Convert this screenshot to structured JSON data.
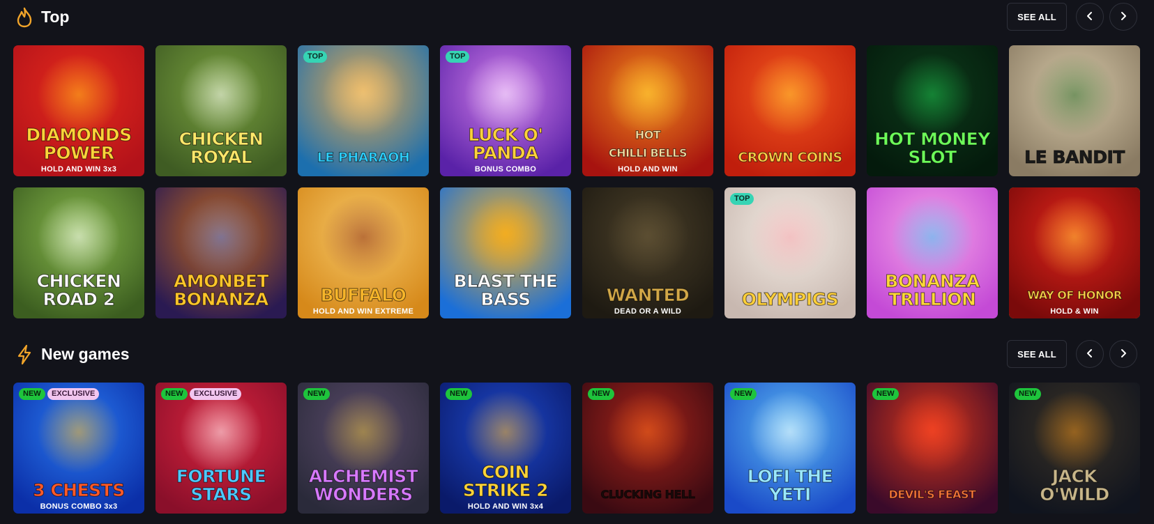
{
  "sections": [
    {
      "title": "Top",
      "icon": "fire-icon",
      "see_all": "SEE ALL",
      "prev_icon": "chevron-left-icon",
      "next_icon": "chevron-right-icon",
      "games": [
        {
          "line1": "DIAMONDS",
          "line2": "POWER",
          "sub": "HOLD AND WIN 3x3",
          "badges": [],
          "bg": [
            "#b3121a",
            "#e42a1c"
          ],
          "glow": "#ffc21a",
          "text": "#ffd43a"
        },
        {
          "line1": "CHICKEN",
          "line2": "ROYAL",
          "sub": "",
          "badges": [],
          "bg": [
            "#3f5c23",
            "#79a03e"
          ],
          "glow": "#ffffff",
          "text": "#ffe86a"
        },
        {
          "line1": "LE PHARAOH",
          "line2": "",
          "sub": "",
          "badges": [
            "TOP"
          ],
          "bg": [
            "#1c6fae",
            "#e2a852"
          ],
          "glow": "#f6d38a",
          "text": "#2fd0ff"
        },
        {
          "line1": "LUCK O'",
          "line2": "PANDA",
          "sub": "BONUS COMBO",
          "badges": [
            "TOP"
          ],
          "bg": [
            "#5a22a8",
            "#d07ce8"
          ],
          "glow": "#f8f0ff",
          "text": "#ffd23c"
        },
        {
          "line1": "HOT",
          "line2": "CHILLI BELLS",
          "sub": "HOLD AND WIN",
          "badges": [],
          "bg": [
            "#a7130f",
            "#f08a1c"
          ],
          "glow": "#ffd33a",
          "text": "#ffe6a8"
        },
        {
          "line1": "CROWN COINS",
          "line2": "",
          "sub": "",
          "badges": [],
          "bg": [
            "#c01e0c",
            "#f2561e"
          ],
          "glow": "#ffcc33",
          "text": "#ffcf48"
        },
        {
          "line1": "HOT MONEY",
          "line2": "SLOT",
          "sub": "",
          "badges": [],
          "bg": [
            "#041a0c",
            "#0d3a1a"
          ],
          "glow": "#1bbd4a",
          "text": "#6dff5a"
        },
        {
          "line1": "LE BANDIT",
          "line2": "",
          "sub": "",
          "badges": [],
          "bg": [
            "#8a7b63",
            "#d6c8a8"
          ],
          "glow": "#2a6a2a",
          "text": "#1a1a1a"
        }
      ]
    },
    {
      "title": "",
      "games": [
        {
          "line1": "CHICKEN",
          "line2": "ROAD 2",
          "sub": "",
          "badges": [],
          "bg": [
            "#3c5e20",
            "#86b64a"
          ],
          "glow": "#ffffff",
          "text": "#ffffff"
        },
        {
          "line1": "AMONBET",
          "line2": "BONANZA",
          "sub": "",
          "badges": [],
          "bg": [
            "#2a1a52",
            "#c46a1c"
          ],
          "glow": "#4b7cf0",
          "text": "#ffc62a"
        },
        {
          "line1": "BUFFALO",
          "line2": "",
          "sub": "HOLD AND WIN EXTREME",
          "badges": [],
          "bg": [
            "#d6891a",
            "#f6c868"
          ],
          "glow": "#8a2a12",
          "text": "#f6b52a"
        },
        {
          "line1": "BLAST THE",
          "line2": "BASS",
          "sub": "",
          "badges": [],
          "bg": [
            "#1b6fd8",
            "#f0b02a"
          ],
          "glow": "#f2a91a",
          "text": "#ffffff"
        },
        {
          "line1": "WANTED",
          "line2": "",
          "sub": "DEAD OR A WILD",
          "badges": [],
          "bg": [
            "#1e1a12",
            "#4a3f28"
          ],
          "glow": "#6a5a3a",
          "text": "#d2a848"
        },
        {
          "line1": "OLYMPIGS",
          "line2": "",
          "sub": "",
          "badges": [
            "TOP"
          ],
          "bg": [
            "#c8b8b0",
            "#f4ece4"
          ],
          "glow": "#f2a0a8",
          "text": "#ffd03a"
        },
        {
          "line1": "BONANZA",
          "line2": "TRILLION",
          "sub": "",
          "badges": [],
          "bg": [
            "#c44ad6",
            "#f4a2e8"
          ],
          "glow": "#3ac3f2",
          "text": "#ffd83a"
        },
        {
          "line1": "WAY OF HONOR",
          "line2": "",
          "sub": "HOLD & WIN",
          "badges": [],
          "bg": [
            "#7a0a0a",
            "#e0241a"
          ],
          "glow": "#ffcf3a",
          "text": "#ffd24a",
          "highlight": true
        }
      ]
    },
    {
      "title": "New games",
      "icon": "lightning-icon",
      "see_all": "SEE ALL",
      "prev_icon": "chevron-left-icon",
      "next_icon": "chevron-right-icon",
      "games": [
        {
          "line1": "3 CHESTS",
          "line2": "",
          "sub": "BONUS COMBO 3x3",
          "badges": [
            "NEW",
            "EXCLUSIVE"
          ],
          "bg": [
            "#0b2fa8",
            "#2a7af0"
          ],
          "glow": "#ffb21a",
          "text": "#ff5a2a"
        },
        {
          "line1": "FORTUNE",
          "line2": "STARS",
          "sub": "",
          "badges": [
            "NEW",
            "EXCLUSIVE"
          ],
          "bg": [
            "#8a0f2a",
            "#d8243e"
          ],
          "glow": "#ffffff",
          "text": "#4fc9ff"
        },
        {
          "line1": "ALCHEMIST",
          "line2": "WONDERS",
          "sub": "",
          "badges": [
            "NEW"
          ],
          "bg": [
            "#2a2a3a",
            "#5a4a6a"
          ],
          "glow": "#d6b43a",
          "text": "#d87aff"
        },
        {
          "line1": "COIN",
          "line2": "STRIKE 2",
          "sub": "HOLD AND WIN 3x4",
          "badges": [
            "NEW"
          ],
          "bg": [
            "#0a1a6a",
            "#1e48c8"
          ],
          "glow": "#ffb41a",
          "text": "#ffd43a"
        },
        {
          "line1": "CLUCKING HELL",
          "line2": "",
          "sub": "",
          "badges": [
            "NEW"
          ],
          "bg": [
            "#3a0a12",
            "#a8241a"
          ],
          "glow": "#f26a1a",
          "text": "#1a0a0a"
        },
        {
          "line1": "LOFI THE",
          "line2": "YETI",
          "sub": "",
          "badges": [
            "NEW"
          ],
          "bg": [
            "#1a4ac8",
            "#5ab8f2"
          ],
          "glow": "#ffffff",
          "text": "#9ae8ff"
        },
        {
          "line1": "DEVIL'S FEAST",
          "line2": "",
          "sub": "",
          "badges": [
            "NEW"
          ],
          "bg": [
            "#3a0a2a",
            "#d8361a"
          ],
          "glow": "#ff4a2a",
          "text": "#ff7a3a"
        },
        {
          "line1": "JACK",
          "line2": "O'WILD",
          "sub": "",
          "badges": [
            "NEW"
          ],
          "bg": [
            "#10141e",
            "#3a3226"
          ],
          "glow": "#e08a1a",
          "text": "#c8b68a"
        }
      ]
    }
  ]
}
